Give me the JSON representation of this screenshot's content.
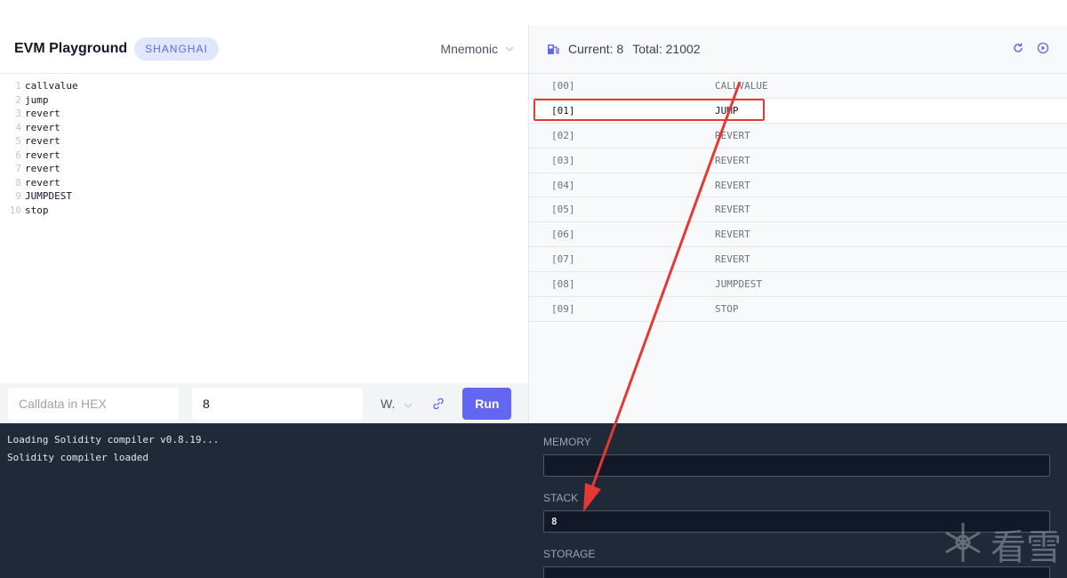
{
  "header": {
    "title": "EVM Playground",
    "badge": "SHANGHAI",
    "mode_select": "Mnemonic"
  },
  "editor": {
    "lines": [
      "callvalue",
      "jump",
      "revert",
      "revert",
      "revert",
      "revert",
      "revert",
      "revert",
      "JUMPDEST",
      "stop"
    ]
  },
  "controls": {
    "calldata_placeholder": "Calldata in HEX",
    "value": "8",
    "unit_select": "W.",
    "run_label": "Run"
  },
  "execution": {
    "current_label": "Current:",
    "current_value": "8",
    "total_label": "Total:",
    "total_value": "21002",
    "ops": [
      {
        "idx": "[00]",
        "op": "CALLVALUE"
      },
      {
        "idx": "[01]",
        "op": "JUMP"
      },
      {
        "idx": "[02]",
        "op": "REVERT"
      },
      {
        "idx": "[03]",
        "op": "REVERT"
      },
      {
        "idx": "[04]",
        "op": "REVERT"
      },
      {
        "idx": "[05]",
        "op": "REVERT"
      },
      {
        "idx": "[06]",
        "op": "REVERT"
      },
      {
        "idx": "[07]",
        "op": "REVERT"
      },
      {
        "idx": "[08]",
        "op": "JUMPDEST"
      },
      {
        "idx": "[09]",
        "op": "STOP"
      }
    ],
    "active_index": 1
  },
  "console": {
    "lines": [
      "Loading Solidity compiler v0.8.19...",
      "Solidity compiler loaded"
    ]
  },
  "state": {
    "memory_label": "MEMORY",
    "memory_value": "",
    "stack_label": "STACK",
    "stack_value": "8",
    "storage_label": "STORAGE",
    "storage_value": ""
  },
  "watermark": {
    "text": "看雪"
  },
  "colors": {
    "accent": "#6366f1",
    "annotation": "#e53935",
    "console_bg": "#1f2937"
  }
}
